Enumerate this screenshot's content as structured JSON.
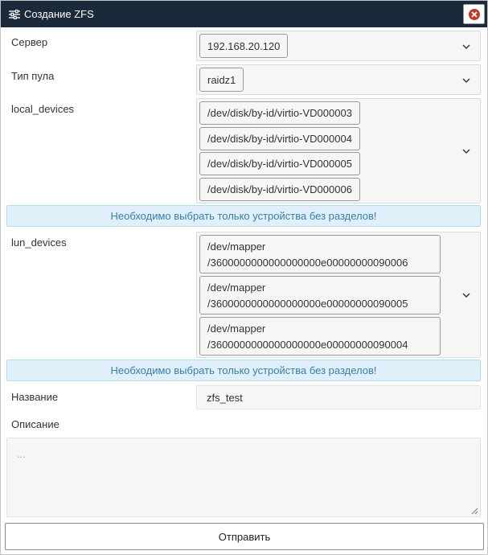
{
  "dialog": {
    "title": "Создание ZFS",
    "icon": "sliders-icon",
    "close_icon": "close-icon"
  },
  "fields": {
    "server": {
      "label": "Сервер",
      "value": "192.168.20.120"
    },
    "pool_type": {
      "label": "Тип пула",
      "value": "raidz1"
    },
    "local_devices": {
      "label": "local_devices",
      "values": [
        "/dev/disk/by-id/virtio-VD000003",
        "/dev/disk/by-id/virtio-VD000004",
        "/dev/disk/by-id/virtio-VD000005",
        "/dev/disk/by-id/virtio-VD000006"
      ],
      "notice": "Необходимо выбрать только устройства без разделов!"
    },
    "lun_devices": {
      "label": "lun_devices",
      "values": [
        {
          "line1": "/dev/mapper",
          "line2": "/3600000000000000000e00000000090006"
        },
        {
          "line1": "/dev/mapper",
          "line2": "/3600000000000000000e00000000090005"
        },
        {
          "line1": "/dev/mapper",
          "line2": "/3600000000000000000e00000000090004"
        }
      ],
      "notice": "Необходимо выбрать только устройства без разделов!"
    },
    "name": {
      "label": "Название",
      "value": "zfs_test"
    },
    "description": {
      "label": "Описание",
      "placeholder": "..."
    }
  },
  "submit_label": "Отправить",
  "colors": {
    "titlebar": "#1b2a3a",
    "close": "#c0392b",
    "notice_bg": "#dff0fb",
    "notice_text": "#3b7ea9"
  }
}
